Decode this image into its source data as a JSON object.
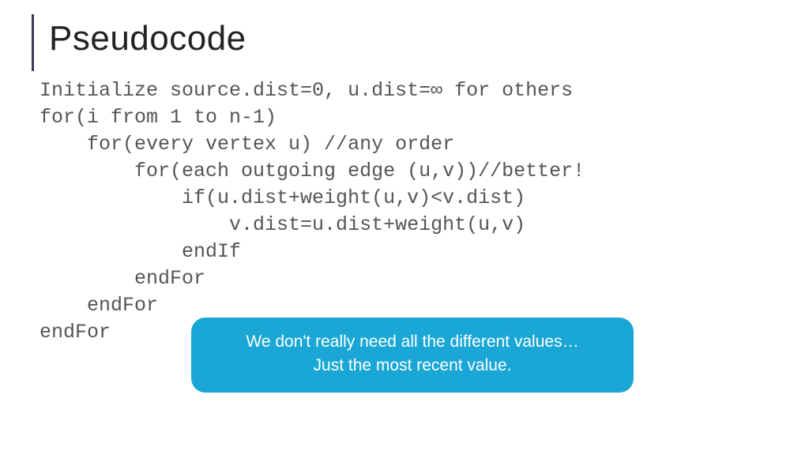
{
  "title": "Pseudocode",
  "code": {
    "l0": "Initialize source.dist=0, u.dist=∞ for others",
    "l1": "for(i from 1 to n-1)",
    "l2": "    for(every vertex u) //any order",
    "l3": "        for(each outgoing edge (u,v))//better!",
    "l4": "            if(u.dist+weight(u,v)<v.dist)",
    "l5": "                v.dist=u.dist+weight(u,v)",
    "l6": "            endIf",
    "l7": "        endFor",
    "l8": "    endFor",
    "l9": "endFor"
  },
  "callout": {
    "line1": "We don't really need all the different values…",
    "line2": "Just the most recent value."
  },
  "colors": {
    "accent_bar": "#3b3b58",
    "callout_bg": "#1aa7d6",
    "code_text": "#555555"
  }
}
